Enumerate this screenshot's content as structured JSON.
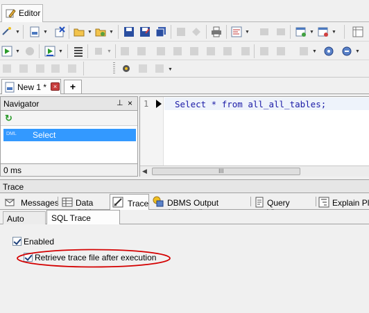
{
  "editor_tab": {
    "label": "Editor"
  },
  "doc_tab": {
    "label": "New 1 *",
    "add_label": "+"
  },
  "navigator": {
    "title": "Navigator",
    "item_prefix": "DML",
    "item_label": "Select",
    "status": "0 ms"
  },
  "editor": {
    "line_number": "1",
    "code": "Select * from all_all_tables;",
    "scrollbar_grip": "III"
  },
  "trace_panel": {
    "title": "Trace"
  },
  "bottom_tabs": [
    {
      "label": "Messages"
    },
    {
      "label": "Data Grid"
    },
    {
      "label": "Trace"
    },
    {
      "label": "DBMS Output (disabled)"
    },
    {
      "label": "Query Viewer"
    },
    {
      "label": "Explain Pla"
    }
  ],
  "sub_tabs": [
    {
      "label": "Auto Trace"
    },
    {
      "label": "SQL Trace (tkprof)"
    }
  ],
  "options": {
    "enabled_label": "Enabled",
    "retrieve_label": "Retrieve trace file after execution"
  },
  "colors": {
    "selection": "#3399ff",
    "code": "#1a1aa6",
    "highlight_oval": "#d40000"
  }
}
